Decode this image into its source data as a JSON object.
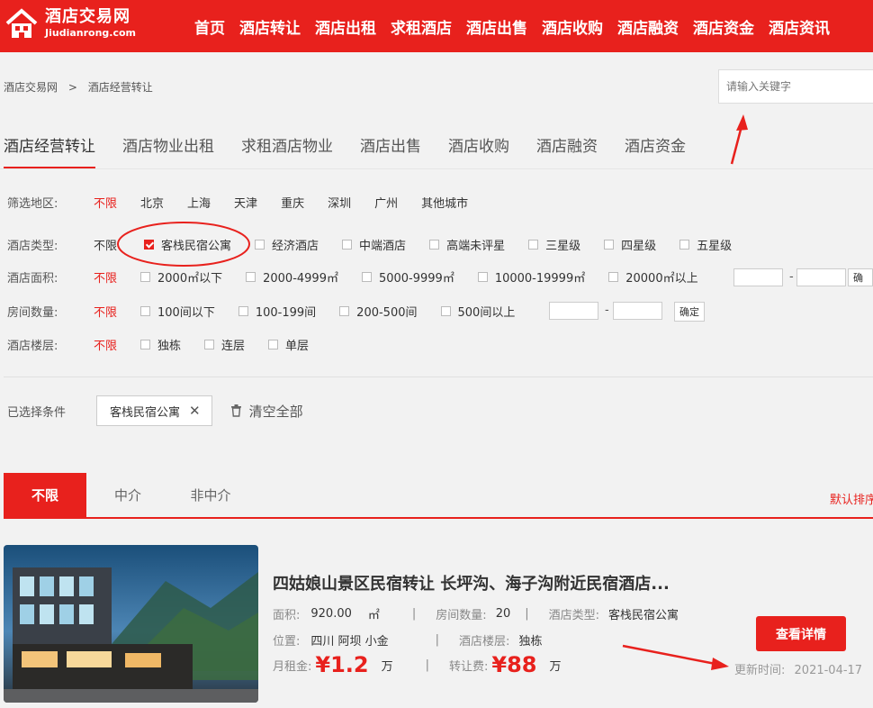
{
  "header": {
    "logo_title": "酒店交易网",
    "logo_subtitle": "Jiudianrong.com",
    "nav": [
      "首页",
      "酒店转让",
      "酒店出租",
      "求租酒店",
      "酒店出售",
      "酒店收购",
      "酒店融资",
      "酒店资金",
      "酒店资讯"
    ]
  },
  "breadcrumb": {
    "home": "酒店交易网",
    "separator": ">",
    "current": "酒店经营转让"
  },
  "search": {
    "placeholder": "请输入关键字"
  },
  "category_tabs": [
    "酒店经营转让",
    "酒店物业出租",
    "求租酒店物业",
    "酒店出售",
    "酒店收购",
    "酒店融资",
    "酒店资金"
  ],
  "filters": {
    "region": {
      "label": "筛选地区:",
      "options": [
        "不限",
        "北京",
        "上海",
        "天津",
        "重庆",
        "深圳",
        "广州",
        "其他城市"
      ]
    },
    "type": {
      "label": "酒店类型:",
      "unlimited": "不限",
      "options": [
        "客栈民宿公寓",
        "经济酒店",
        "中端酒店",
        "高端未评星",
        "三星级",
        "四星级",
        "五星级"
      ]
    },
    "area": {
      "label": "酒店面积:",
      "unlimited": "不限",
      "options": [
        "2000㎡以下",
        "2000-4999㎡",
        "5000-9999㎡",
        "10000-19999㎡",
        "20000㎡以上"
      ],
      "dash": "-",
      "confirm": "确"
    },
    "rooms": {
      "label": "房间数量:",
      "unlimited": "不限",
      "options": [
        "100间以下",
        "100-199间",
        "200-500间",
        "500间以上"
      ],
      "dash": "-",
      "confirm": "确定"
    },
    "floors": {
      "label": "酒店楼层:",
      "unlimited": "不限",
      "options": [
        "独栋",
        "连层",
        "单层"
      ]
    }
  },
  "selected": {
    "label": "已选择条件",
    "tag": "客栈民宿公寓",
    "remove": "✕",
    "clear": "清空全部"
  },
  "type_tabs": [
    "不限",
    "中介",
    "非中介"
  ],
  "sort_label": "默认排序",
  "listing": {
    "title": "四姑娘山景区民宿转让 长坪沟、海子沟附近民宿酒店...",
    "area_label": "面积:",
    "area_value": "920.00",
    "area_unit": "㎡",
    "rooms_label": "房间数量:",
    "rooms_value": "20",
    "type_label": "酒店类型:",
    "type_value": "客栈民宿公寓",
    "location_label": "位置:",
    "location_value": "四川 阿坝 小金",
    "floor_label": "酒店楼层:",
    "floor_value": "独栋",
    "rent_label": "月租金:",
    "rent_value": "¥1.2",
    "rent_unit": "万",
    "fee_label": "转让费:",
    "fee_value": "¥88",
    "fee_unit": "万",
    "bar": "|",
    "detail_button": "查看详情",
    "update_label": "更新时间:",
    "update_value": "2021-04-17"
  },
  "colors": {
    "brand": "#e8211d",
    "annotation": "#e8211d"
  }
}
